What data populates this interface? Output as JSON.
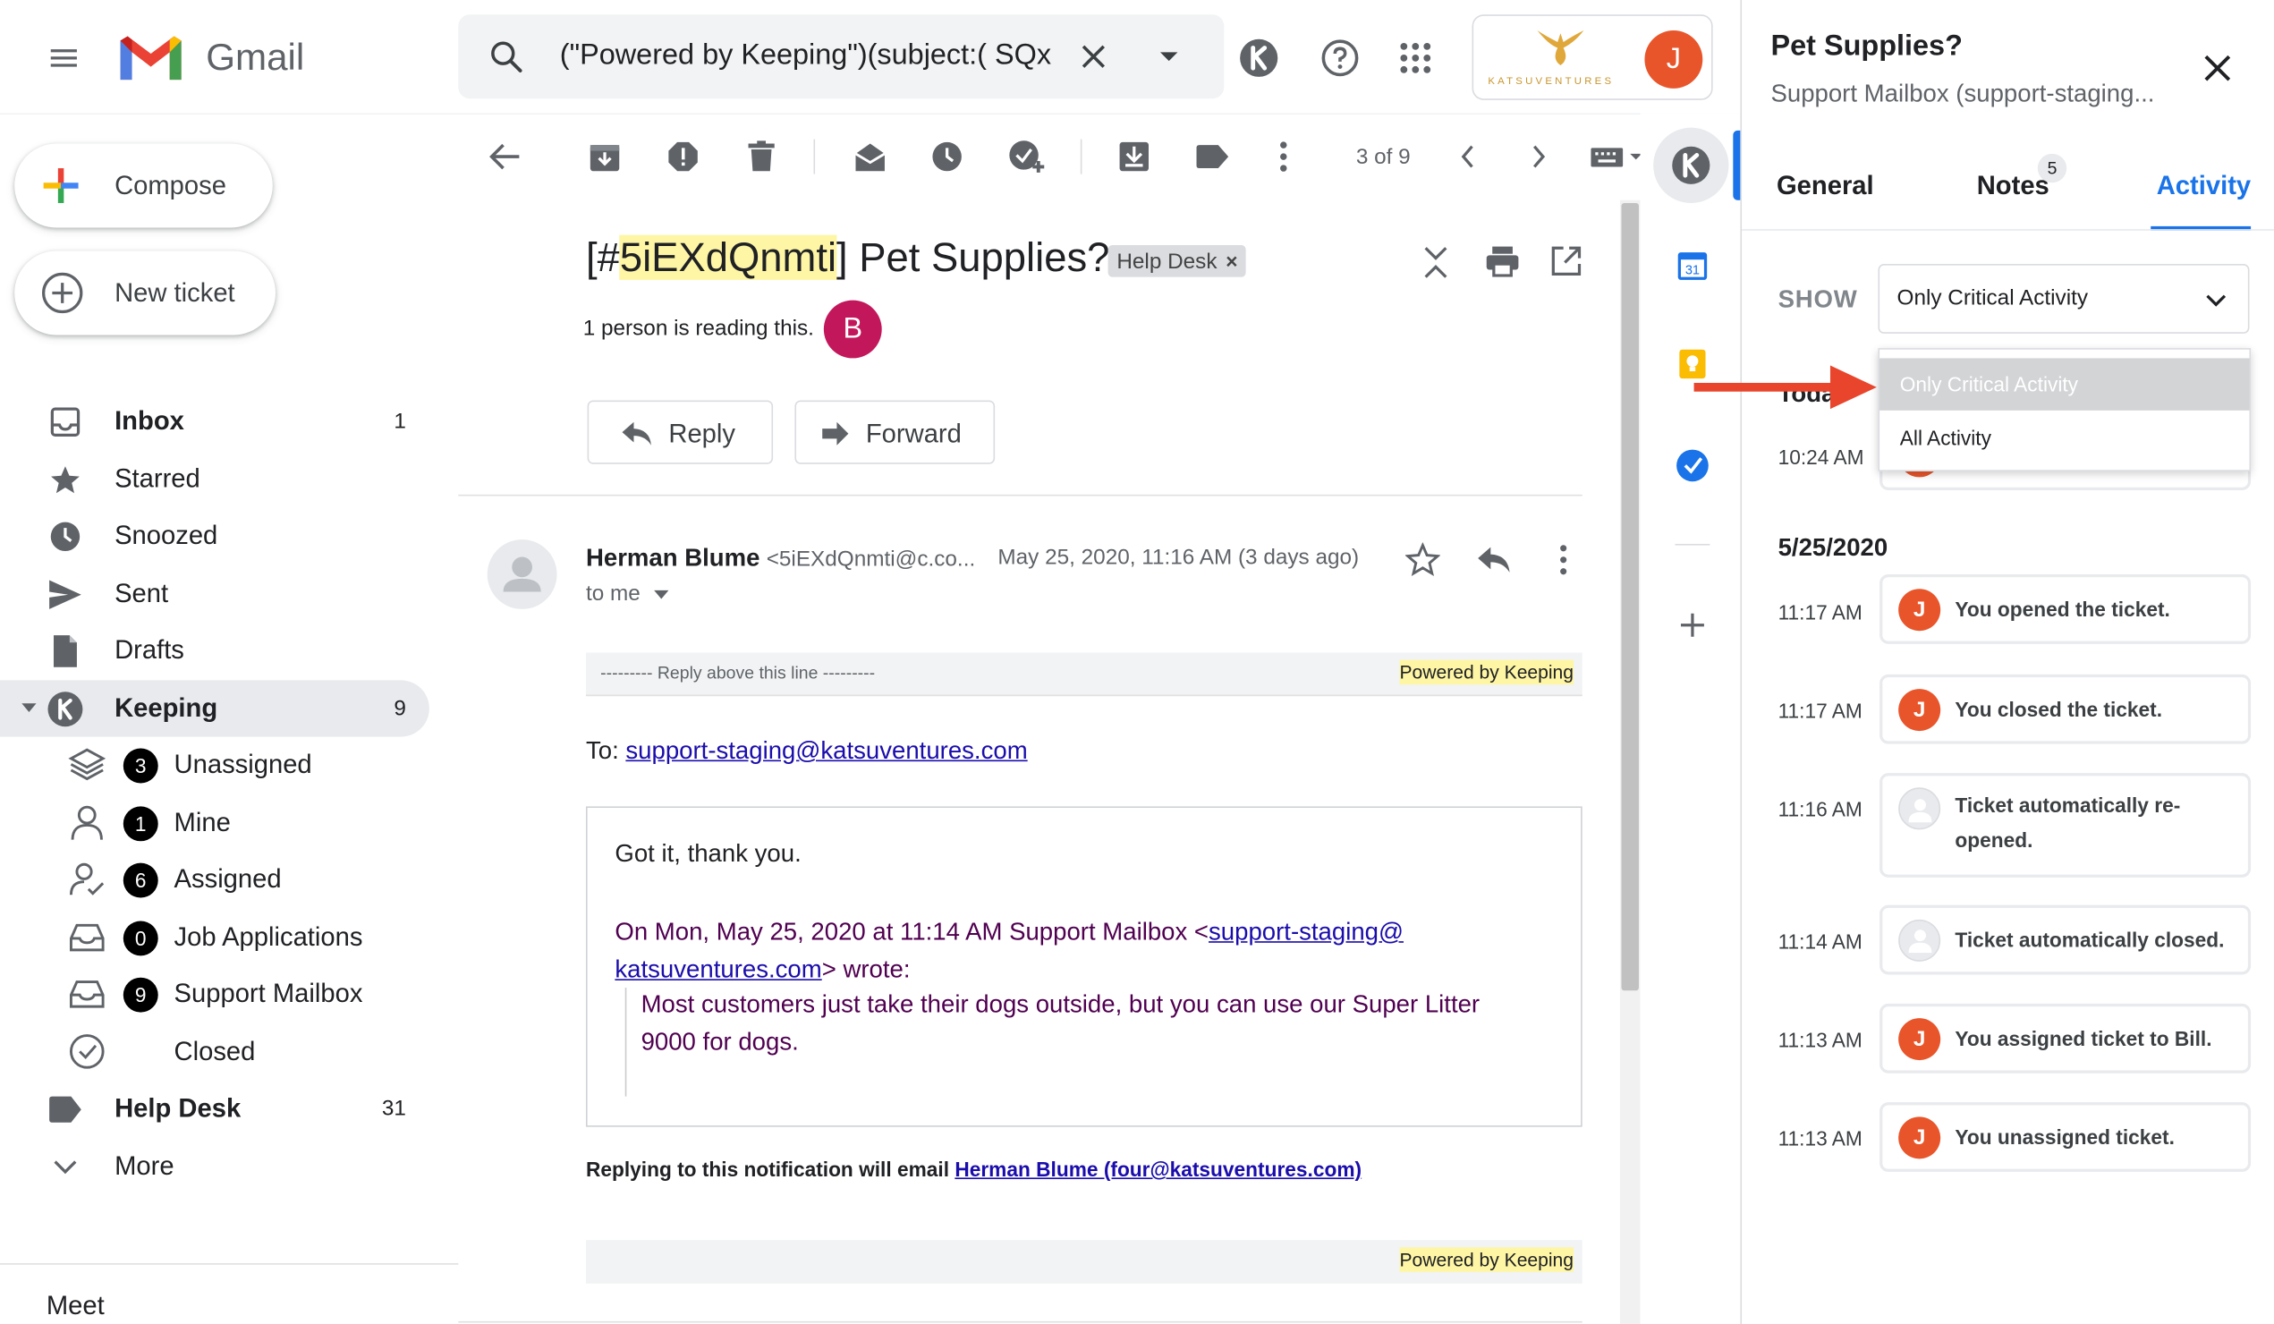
{
  "app": {
    "name": "Gmail"
  },
  "search": {
    "query": "(\"Powered by Keeping\")(subject:( SQx"
  },
  "brand": {
    "name": "KATSUVENTURES"
  },
  "user": {
    "initial": "J"
  },
  "sidebar": {
    "compose_label": "Compose",
    "new_ticket_label": "New ticket",
    "items": [
      {
        "label": "Inbox",
        "count": "1"
      },
      {
        "label": "Starred",
        "count": ""
      },
      {
        "label": "Snoozed",
        "count": ""
      },
      {
        "label": "Sent",
        "count": ""
      },
      {
        "label": "Drafts",
        "count": ""
      },
      {
        "label": "Keeping",
        "count": "9"
      }
    ],
    "keeping_children": [
      {
        "label": "Unassigned",
        "badge": "3"
      },
      {
        "label": "Mine",
        "badge": "1"
      },
      {
        "label": "Assigned",
        "badge": "6"
      },
      {
        "label": "Job Applications",
        "badge": "0"
      },
      {
        "label": "Support Mailbox",
        "badge": "9"
      },
      {
        "label": "Closed",
        "badge": ""
      }
    ],
    "help_desk": {
      "label": "Help Desk",
      "count": "31"
    },
    "more_label": "More",
    "meet_label": "Meet"
  },
  "toolbar": {
    "pagination": "3 of 9"
  },
  "email": {
    "subject_prefix": "[#",
    "subject_id": "5iEXdQnmti",
    "subject_suffix": "] Pet Supplies?",
    "label_chip": "Help Desk",
    "readers_text": "1 person is reading this.",
    "reader_initial": "B",
    "reply_label": "Reply",
    "forward_label": "Forward",
    "sender_name": "Herman Blume",
    "sender_email": "<5iEXdQnmti@c.co...",
    "date": "May 25, 2020, 11:16 AM (3 days ago)",
    "to_me": "to me",
    "reply_above": "--------- Reply above this line ---------",
    "powered_by": "Powered by Keeping",
    "to_label": "To: ",
    "to_address": "support-staging@katsuventures.com",
    "body_text": "Got it, thank you.",
    "quote_header_a": "On Mon, May 25, 2020 at 11:14 AM Support Mailbox <",
    "quote_link_a": "support-staging@",
    "quote_link_b": "katsuventures.com",
    "quote_header_b": "> wrote:",
    "quote_line_1": "Most customers just take their dogs outside, but you can use our Super Litter",
    "quote_line_2": "9000 for dogs.",
    "footer_note": "Replying to this notification will email ",
    "footer_link": "Herman Blume (four@katsuventures.com)",
    "powered_by_2": "Powered by Keeping"
  },
  "panel": {
    "title": "Pet Supplies?",
    "subtitle": "Support Mailbox (support-staging...",
    "tabs": [
      {
        "label": "General"
      },
      {
        "label": "Notes",
        "badge": "5"
      },
      {
        "label": "Activity"
      }
    ],
    "show_label": "SHOW",
    "show_value": "Only Critical Activity",
    "dropdown_options": [
      "Only Critical Activity",
      "All Activity"
    ],
    "today_partial": "Toda",
    "today_time": "10:24 AM",
    "date_heading": "5/25/2020",
    "activities": [
      {
        "time": "11:17 AM",
        "text": "You opened the ticket.",
        "avatar": "J"
      },
      {
        "time": "11:17 AM",
        "text": "You closed the ticket.",
        "avatar": "J"
      },
      {
        "time": "11:16 AM",
        "text": "Ticket automatically re-opened.",
        "avatar": ""
      },
      {
        "time": "11:14 AM",
        "text": "Ticket automatically closed.",
        "avatar": ""
      },
      {
        "time": "11:13 AM",
        "text": "You assigned ticket to Bill.",
        "avatar": "J"
      },
      {
        "time": "11:13 AM",
        "text": "You unassigned ticket.",
        "avatar": "J"
      }
    ]
  },
  "colors": {
    "accent": "#1a73e8",
    "user_avatar": "#e8552b",
    "reader_avatar": "#c2185b",
    "arrow": "#e8452c",
    "highlight": "#fef6a5"
  }
}
